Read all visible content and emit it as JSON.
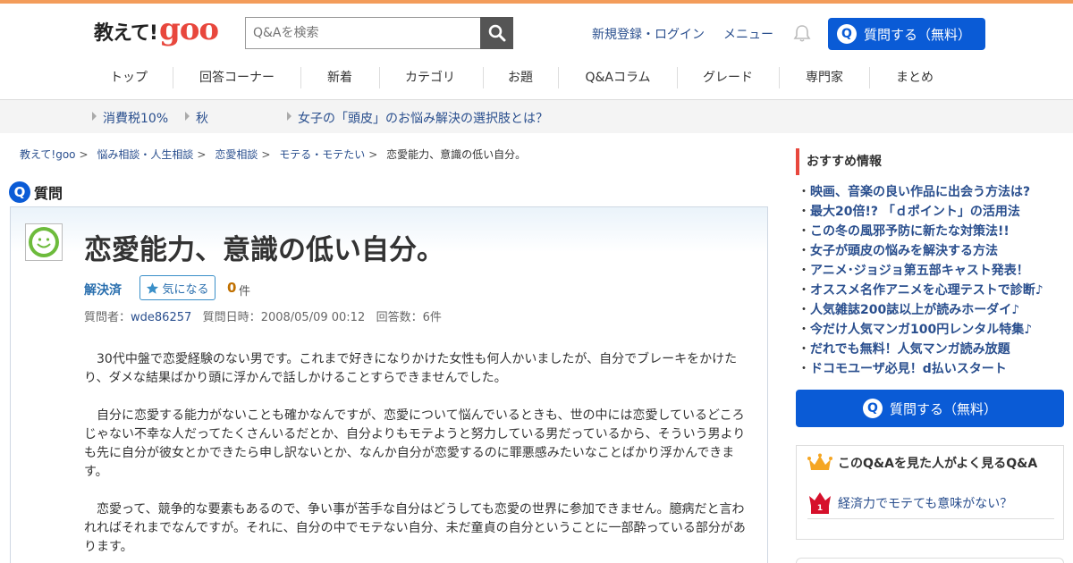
{
  "header": {
    "logo_jp": "教えて!",
    "logo_goo": "goo",
    "search_placeholder": "Q&Aを検索",
    "signup_login": "新規登録・ログイン",
    "menu": "メニュー",
    "ask_button": "質問する（無料）",
    "q_mark": "Q"
  },
  "nav": {
    "items": [
      "トップ",
      "回答コーナー",
      "新着",
      "カテゴリ",
      "お題",
      "Q&Aコラム",
      "グレード",
      "専門家",
      "まとめ"
    ]
  },
  "ticker": {
    "items": [
      "消費税10%",
      "秋",
      "女子の「頭皮」のお悩み解決の選択肢とは？"
    ]
  },
  "breadcrumb": {
    "items": [
      "教えて!goo",
      "悩み相談・人生相談",
      "恋愛相談",
      "モテる・モテたい"
    ],
    "current": "恋愛能力、意識の低い自分。",
    "separator": ">"
  },
  "question": {
    "section_label": "質問",
    "q_mark": "Q",
    "title": "恋愛能力、意識の低い自分。",
    "status": "解決済",
    "watch_label": "気になる",
    "watch_count": "0",
    "watch_unit": "件",
    "asker_label": "質問者：",
    "asker": "wde86257",
    "date_label": "質問日時：",
    "date": "2008/05/09 00:12",
    "answers_label": "回答数：",
    "answers": "6件",
    "body": [
      "30代中盤で恋愛経験のない男です。これまで好きになりかけた女性も何人かいましたが、自分でブレーキをかけたり、ダメな結果ばかり頭に浮かんで話しかけることすらできませんでした。",
      "自分に恋愛する能力がないことも確かなんですが、恋愛について悩んでいるときも、世の中には恋愛しているどころじゃない不幸な人だってたくさんいるだとか、自分よりもモテようと努力している男だっているから、そういう男よりも先に自分が彼女とかできたら申し訳ないとか、なんか自分が恋愛するのに罪悪感みたいなことばかり浮かんできます。",
      "恋愛って、競争的な要素もあるので、争い事が苦手な自分はどうしても恋愛の世界に参加できません。臆病だと言われればそれまでなんですが。それに、自分の中でモテない自分、未だ童貞の自分ということに一部酔っている部分があります。"
    ]
  },
  "sidebar": {
    "recommend_title": "おすすめ情報",
    "recommend": [
      "映画、音楽の良い作品に出会う方法は?",
      "最大20倍!? 「ｄポイント」の活用法",
      "この冬の風邪予防に新たな対策法!!",
      "女子が頭皮の悩みを解決する方法",
      "アニメ･ジョジョ第五部キャスト発表！",
      "オススメ名作アニメを心理テストで診断♪",
      "人気雑誌200誌以上が読みホーダイ♪",
      "今だけ人気マンガ100円レンタル特集♪",
      "だれでも無料！人気マンガ読み放題",
      "ドコモユーザ必見！d払いスタート"
    ],
    "ask_button": "質問する（無料）",
    "popular_title": "このQ&Aを見た人がよく見るQ&A",
    "popular_item": "経済力でモテても意味がない？",
    "popular_rank": "1"
  },
  "colors": {
    "accent_blue": "#0a5bd6",
    "link": "#2a4f8e",
    "brand_red": "#e8473d",
    "top_stripe": "#f39c5a",
    "smiley_green": "#6dbb3c"
  }
}
